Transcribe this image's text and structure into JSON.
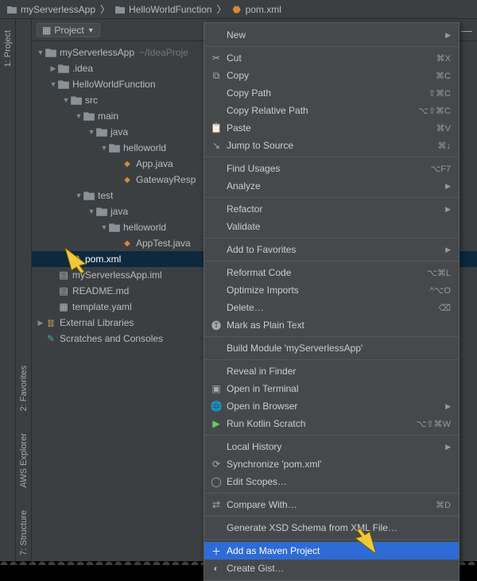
{
  "breadcrumb": {
    "items": [
      {
        "icon": "folder",
        "label": "myServerlessApp"
      },
      {
        "icon": "folder",
        "label": "HelloWorldFunction"
      },
      {
        "icon": "pom",
        "label": "pom.xml"
      }
    ]
  },
  "toolstrip_left_outer": [
    {
      "label": "1: Project"
    }
  ],
  "toolstrip_left_inner": [
    {
      "label": "2: Favorites"
    },
    {
      "label": "AWS Explorer"
    },
    {
      "label": "7: Structure"
    }
  ],
  "panel": {
    "title": "Project"
  },
  "tree": {
    "root_hint": "~/IdeaProje",
    "nodes": [
      {
        "depth": 0,
        "expanded": true,
        "icon": "folder",
        "label": "myServerlessApp",
        "hint": "~/IdeaProje"
      },
      {
        "depth": 1,
        "expanded": false,
        "icon": "folder",
        "label": ".idea"
      },
      {
        "depth": 1,
        "expanded": true,
        "icon": "folder",
        "label": "HelloWorldFunction"
      },
      {
        "depth": 2,
        "expanded": true,
        "icon": "folder",
        "label": "src"
      },
      {
        "depth": 3,
        "expanded": true,
        "icon": "folder",
        "label": "main"
      },
      {
        "depth": 4,
        "expanded": true,
        "icon": "folder",
        "label": "java"
      },
      {
        "depth": 5,
        "expanded": true,
        "icon": "folder",
        "label": "helloworld"
      },
      {
        "depth": 6,
        "expanded": null,
        "icon": "java",
        "label": "App.java"
      },
      {
        "depth": 6,
        "expanded": null,
        "icon": "java",
        "label": "GatewayResp"
      },
      {
        "depth": 3,
        "expanded": true,
        "icon": "folder",
        "label": "test"
      },
      {
        "depth": 4,
        "expanded": true,
        "icon": "folder",
        "label": "java"
      },
      {
        "depth": 5,
        "expanded": true,
        "icon": "folder",
        "label": "helloworld"
      },
      {
        "depth": 6,
        "expanded": null,
        "icon": "java",
        "label": "AppTest.java"
      },
      {
        "depth": 2,
        "expanded": null,
        "icon": "pom",
        "label": "pom.xml",
        "selected": true
      },
      {
        "depth": 1,
        "expanded": null,
        "icon": "file",
        "label": "myServerlessApp.iml"
      },
      {
        "depth": 1,
        "expanded": null,
        "icon": "md",
        "label": "README.md"
      },
      {
        "depth": 1,
        "expanded": null,
        "icon": "yaml",
        "label": "template.yaml"
      },
      {
        "depth": 0,
        "expanded": false,
        "icon": "lib",
        "label": "External Libraries"
      },
      {
        "depth": 0,
        "expanded": null,
        "icon": "scratch",
        "label": "Scratches and Consoles"
      }
    ]
  },
  "context_menu": {
    "items": [
      {
        "type": "item",
        "icon": "",
        "label": "New",
        "submenu": true
      },
      {
        "type": "sep"
      },
      {
        "type": "item",
        "icon": "cut",
        "label": "Cut",
        "shortcut": "⌘X"
      },
      {
        "type": "item",
        "icon": "copy",
        "label": "Copy",
        "shortcut": "⌘C"
      },
      {
        "type": "item",
        "icon": "",
        "label": "Copy Path",
        "shortcut": "⇧⌘C"
      },
      {
        "type": "item",
        "icon": "",
        "label": "Copy Relative Path",
        "shortcut": "⌥⇧⌘C"
      },
      {
        "type": "item",
        "icon": "paste",
        "label": "Paste",
        "shortcut": "⌘V"
      },
      {
        "type": "item",
        "icon": "jump",
        "label": "Jump to Source",
        "shortcut": "⌘↓"
      },
      {
        "type": "sep"
      },
      {
        "type": "item",
        "icon": "",
        "label": "Find Usages",
        "shortcut": "⌥F7"
      },
      {
        "type": "item",
        "icon": "",
        "label": "Analyze",
        "submenu": true
      },
      {
        "type": "sep"
      },
      {
        "type": "item",
        "icon": "",
        "label": "Refactor",
        "submenu": true
      },
      {
        "type": "item",
        "icon": "",
        "label": "Validate"
      },
      {
        "type": "sep"
      },
      {
        "type": "item",
        "icon": "",
        "label": "Add to Favorites",
        "submenu": true
      },
      {
        "type": "sep"
      },
      {
        "type": "item",
        "icon": "",
        "label": "Reformat Code",
        "shortcut": "⌥⌘L"
      },
      {
        "type": "item",
        "icon": "",
        "label": "Optimize Imports",
        "shortcut": "^⌥O"
      },
      {
        "type": "item",
        "icon": "",
        "label": "Delete…",
        "shortcut": "⌫"
      },
      {
        "type": "item",
        "icon": "text",
        "label": "Mark as Plain Text"
      },
      {
        "type": "sep"
      },
      {
        "type": "item",
        "icon": "",
        "label": "Build Module 'myServerlessApp'"
      },
      {
        "type": "sep"
      },
      {
        "type": "item",
        "icon": "",
        "label": "Reveal in Finder"
      },
      {
        "type": "item",
        "icon": "term",
        "label": "Open in Terminal"
      },
      {
        "type": "item",
        "icon": "globe",
        "label": "Open in Browser",
        "submenu": true
      },
      {
        "type": "item",
        "icon": "run",
        "label": "Run Kotlin Scratch",
        "shortcut": "⌥⇧⌘W"
      },
      {
        "type": "sep"
      },
      {
        "type": "item",
        "icon": "",
        "label": "Local History",
        "submenu": true
      },
      {
        "type": "item",
        "icon": "sync",
        "label": "Synchronize 'pom.xml'"
      },
      {
        "type": "item",
        "icon": "scopes",
        "label": "Edit Scopes…"
      },
      {
        "type": "sep"
      },
      {
        "type": "item",
        "icon": "diff",
        "label": "Compare With…",
        "shortcut": "⌘D"
      },
      {
        "type": "sep"
      },
      {
        "type": "item",
        "icon": "",
        "label": "Generate XSD Schema from XML File…"
      },
      {
        "type": "sep"
      },
      {
        "type": "item",
        "icon": "plus",
        "label": "Add as Maven Project",
        "highlight": true
      },
      {
        "type": "item",
        "icon": "github",
        "label": "Create Gist…"
      }
    ]
  }
}
